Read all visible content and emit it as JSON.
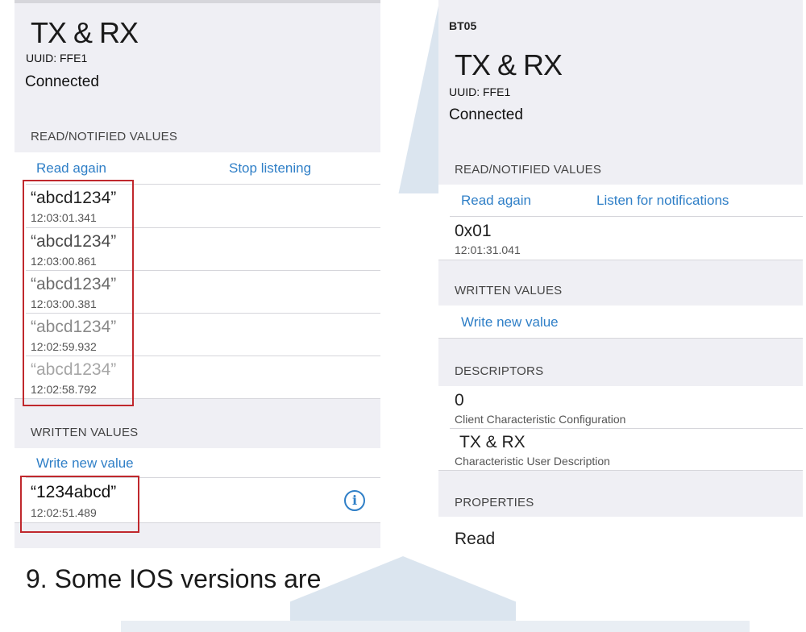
{
  "left": {
    "title": "TX & RX",
    "uuid": "UUID: FFE1",
    "status": "Connected",
    "read_section": "READ/NOTIFIED VALUES",
    "read_again": "Read again",
    "stop_listening": "Stop listening",
    "values": [
      {
        "value": "“abcd1234”",
        "time": "12:03:01.341"
      },
      {
        "value": "“abcd1234”",
        "time": "12:03:00.861"
      },
      {
        "value": "“abcd1234”",
        "time": "12:03:00.381"
      },
      {
        "value": "“abcd1234”",
        "time": "12:02:59.932"
      },
      {
        "value": "“abcd1234”",
        "time": "12:02:58.792"
      }
    ],
    "written_section": "WRITTEN VALUES",
    "write_new": "Write new value",
    "written": {
      "value": "“1234abcd”",
      "time": "12:02:51.489"
    },
    "info_glyph": "i"
  },
  "right": {
    "device": "BT05",
    "title": "TX & RX",
    "uuid": "UUID: FFE1",
    "status": "Connected",
    "read_section": "READ/NOTIFIED VALUES",
    "read_again": "Read again",
    "listen": "Listen for notifications",
    "read_value": "0x01",
    "read_time": "12:01:31.041",
    "written_section": "WRITTEN VALUES",
    "write_new": "Write new value",
    "descriptors_section": "DESCRIPTORS",
    "descriptors": [
      {
        "value": "0",
        "label": "Client Characteristic Configuration"
      },
      {
        "value": "TX & RX",
        "label": "Characteristic User Description"
      }
    ],
    "properties_section": "PROPERTIES",
    "property_first": "Read"
  },
  "caption": "9. Some IOS versions are",
  "colors": {
    "link": "#2f7fc7",
    "highlight": "#c0282d",
    "panel_bg": "#efeff4"
  }
}
